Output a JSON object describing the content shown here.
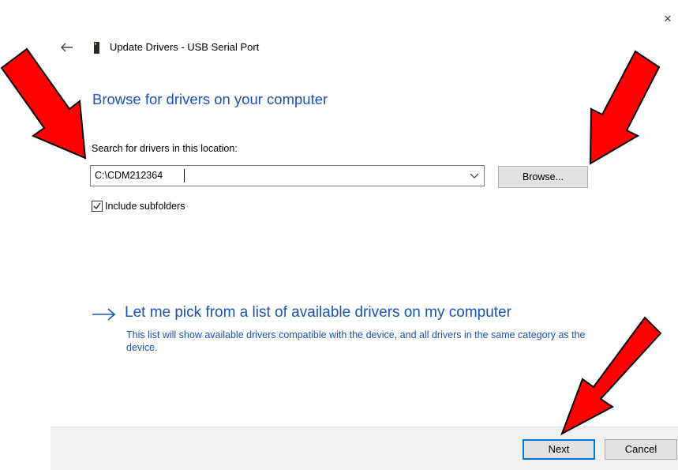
{
  "window": {
    "title": "Update Drivers - USB Serial Port",
    "close_glyph": "×",
    "back_icon": "back-arrow-icon",
    "device_icon": "usb-device-icon"
  },
  "main": {
    "heading": "Browse for drivers on your computer",
    "search_label": "Search for drivers in this location:",
    "path_value": "C:\\CDM212364",
    "browse_label": "Browse...",
    "include_subfolders": {
      "label": "Include subfolders",
      "checked": true
    },
    "pick_title": "Let me pick from a list of available drivers on my computer",
    "pick_description": "This list will show available drivers compatible with the device, and all drivers in the same category as the device."
  },
  "footer": {
    "next_label": "Next",
    "cancel_label": "Cancel"
  },
  "colors": {
    "accent_blue": "#1a52b5",
    "focus_blue": "#0078d7",
    "annotation_red": "#ff0000",
    "footer_bg": "#f0f0f0"
  }
}
